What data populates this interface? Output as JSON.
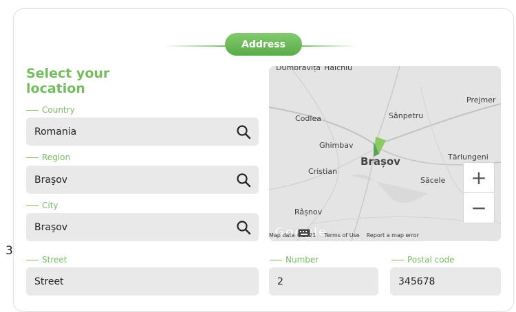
{
  "stray_text": "3",
  "section": {
    "title": "Address"
  },
  "form": {
    "heading": "Select your location",
    "country": {
      "label": "Country",
      "value": "Romania"
    },
    "region": {
      "label": "Region",
      "value": "Braşov"
    },
    "city": {
      "label": "City",
      "value": "Braşov"
    },
    "street": {
      "label": "Street",
      "value": "Street"
    },
    "number": {
      "label": "Number",
      "value": "2"
    },
    "postal": {
      "label": "Postal code",
      "value": "345678"
    }
  },
  "map": {
    "places": {
      "dumbravita": "Dumbrăvița",
      "halchiu": "Hălchiu",
      "prejmer": "Prejmer",
      "codlea": "Codlea",
      "sanpetru": "Sânpetru",
      "ghimbav": "Ghimbav",
      "brasov": "Brașov",
      "tarlungeni": "Tărlungeni",
      "cristian": "Cristian",
      "sacele": "Săcele",
      "rasnov": "Râșnov"
    },
    "zoom_in": "+",
    "zoom_out": "−",
    "google_logo": "Google",
    "attribution": "Map data ©2021",
    "terms": "Terms of Use",
    "report": "Report a map error"
  },
  "colors": {
    "accent": "#6cba5e",
    "field_bg": "#e9e9e9",
    "label": "#77bb62"
  }
}
